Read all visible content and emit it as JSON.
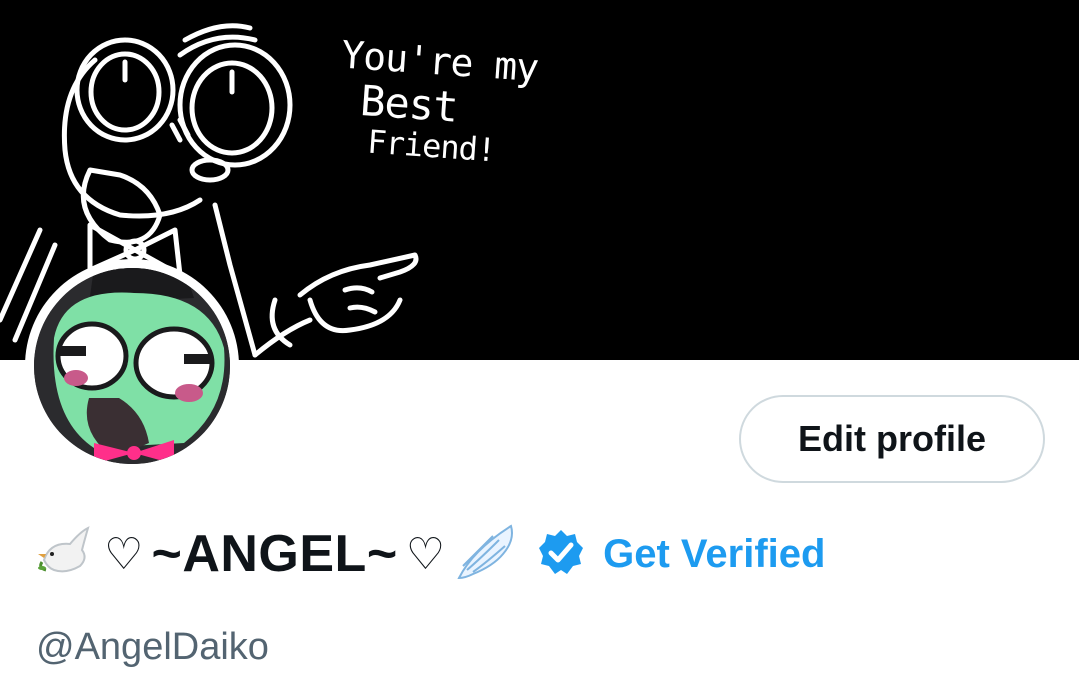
{
  "banner": {
    "caption_line1": "You're my",
    "caption_line2": "Best",
    "caption_line3": "Friend!"
  },
  "profile": {
    "edit_button_label": "Edit profile",
    "name_prefix_emoji": "dove-emoji",
    "heart_left": "♡",
    "display_name": "~ANGEL~",
    "heart_right": "♡",
    "name_suffix_emoji": "wing-emoji",
    "verified_icon": "verified-badge-icon",
    "get_verified_label": "Get Verified",
    "handle": "@AngelDaiko"
  },
  "colors": {
    "banner_bg": "#000000",
    "accent_blue": "#1d9bf0",
    "text_primary": "#0f1419",
    "text_secondary": "#536471",
    "button_border": "#cfd9de"
  }
}
